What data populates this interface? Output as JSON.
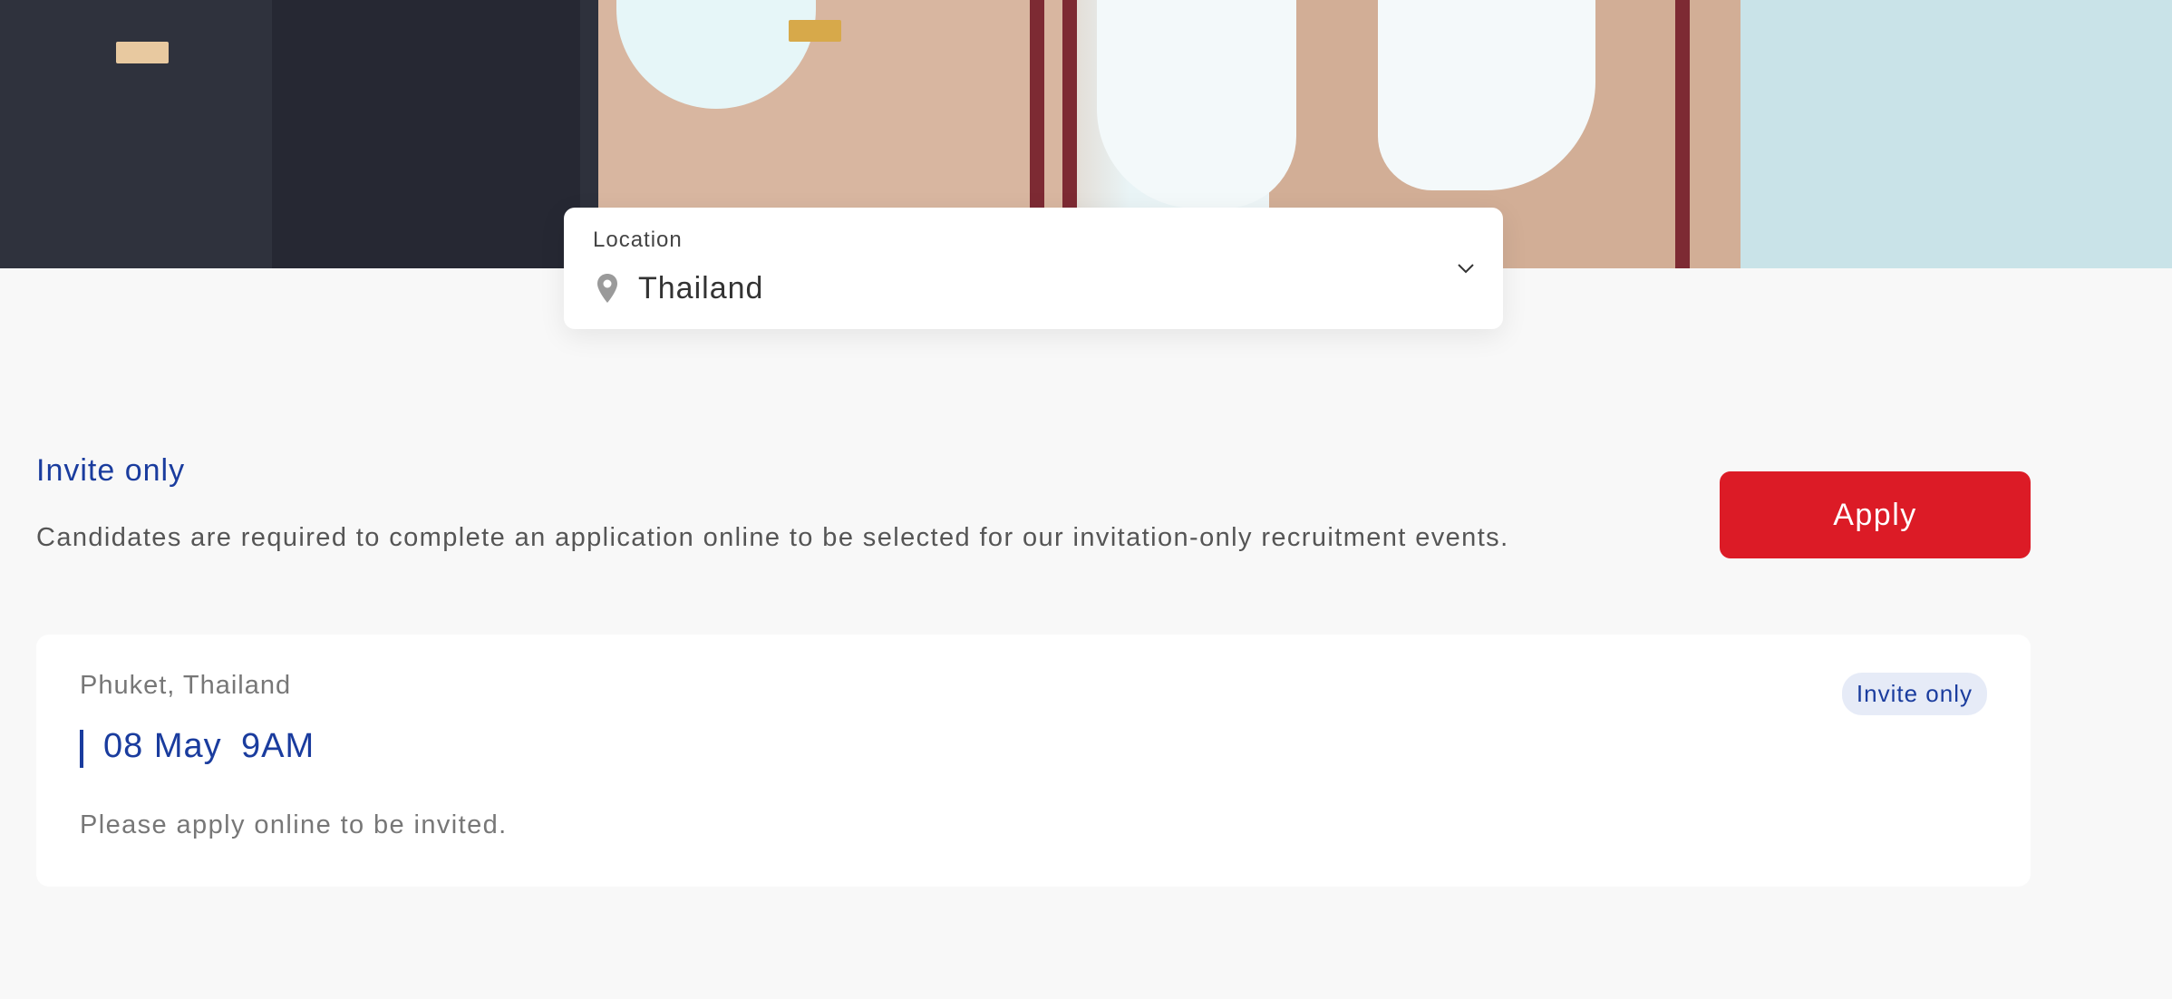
{
  "hero": {
    "image_alt": "crew-members-photo"
  },
  "location": {
    "label": "Location",
    "value": "Thailand",
    "pin_icon": "location-pin-icon",
    "chevron_icon": "chevron-down-icon"
  },
  "section": {
    "title": "Invite only",
    "description": "Candidates are required to complete an application online to be selected for our invitation-only recruitment events.",
    "apply_label": "Apply"
  },
  "event": {
    "location": "Phuket, Thailand",
    "date": "08 May",
    "time": "9AM",
    "note": "Please apply online to be invited.",
    "badge": "Invite only"
  },
  "colors": {
    "primary_blue": "#1a3c9e",
    "apply_red": "#dc1b26",
    "background": "#f8f8f8",
    "badge_bg": "#e6ebf7"
  }
}
